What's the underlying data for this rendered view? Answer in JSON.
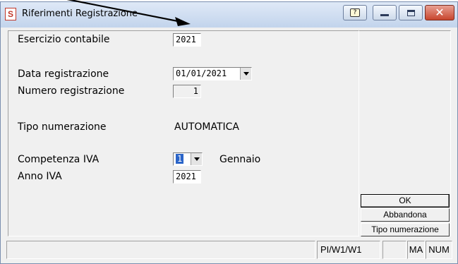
{
  "window": {
    "title": "Riferimenti Registrazione",
    "app_icon_letter": "S",
    "title_buttons": [
      "help-icon",
      "minimize-icon",
      "maximize-icon",
      "close-icon"
    ]
  },
  "form": {
    "esercizio": {
      "label": "Esercizio contabile",
      "value": "2021"
    },
    "data_reg": {
      "label": "Data registrazione",
      "value": "01/01/2021"
    },
    "numero_reg": {
      "label": "Numero registrazione",
      "value": "1"
    },
    "tipo_num": {
      "label": "Tipo numerazione",
      "value": "AUTOMATICA"
    },
    "competenza": {
      "label": "Competenza IVA",
      "value": "1",
      "month": "Gennaio"
    },
    "anno_iva": {
      "label": "Anno IVA",
      "value": "2021"
    }
  },
  "buttons": {
    "ok": "OK",
    "abbandona": "Abbandona",
    "tipo_numerazione": "Tipo numerazione"
  },
  "statusbar": {
    "path": "PI/W1/W1",
    "ma": "MA",
    "num": "NUM"
  },
  "colors": {
    "selection": "#2a64c8",
    "annotation_arrow": "#000000"
  }
}
